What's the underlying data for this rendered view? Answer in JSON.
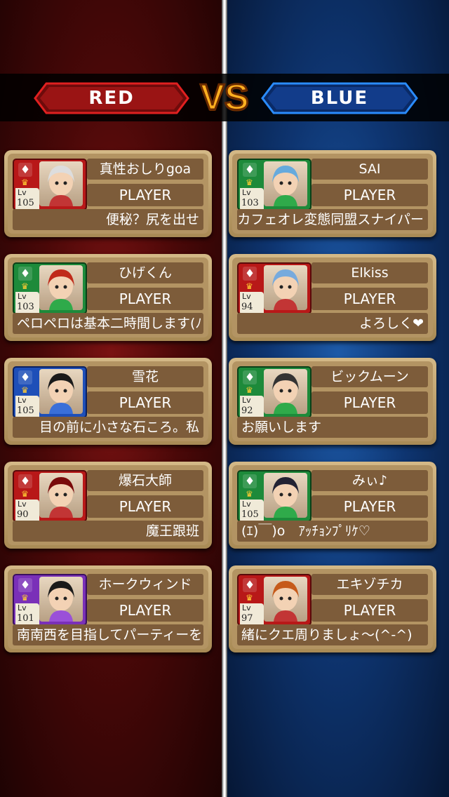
{
  "teams": {
    "red": "RED",
    "vs": "VS",
    "blue": "BLUE"
  },
  "colors": {
    "red_team": "#b81818",
    "blue_team": "#1e4fb8",
    "vs_orange": "#ffb020"
  },
  "red_players": [
    {
      "name": "真性おしりgoa",
      "role": "PLAYER",
      "level": "105",
      "lv_label": "Lv",
      "message": "便秘？尻を出せ",
      "frame": "red",
      "gem": "♦"
    },
    {
      "name": "ひげくん",
      "role": "PLAYER",
      "level": "103",
      "lv_label": "Lv",
      "message": "ペロペロは基本二時間します(ﾉ",
      "frame": "green",
      "gem": "♦"
    },
    {
      "name": "雪花",
      "role": "PLAYER",
      "level": "105",
      "lv_label": "Lv",
      "message": "目の前に小さな石ころ。私",
      "frame": "blue",
      "gem": "♦"
    },
    {
      "name": "爆石大師",
      "role": "PLAYER",
      "level": "90",
      "lv_label": "Lv",
      "message": "魔王跟班",
      "frame": "red",
      "gem": "♦"
    },
    {
      "name": "ホークウィンド",
      "role": "PLAYER",
      "level": "101",
      "lv_label": "Lv",
      "message": "南南西を目指してパーティーを",
      "frame": "purple",
      "gem": "♦"
    }
  ],
  "blue_players": [
    {
      "name": "SAI",
      "role": "PLAYER",
      "level": "103",
      "lv_label": "Lv",
      "message": "カフェオレ変態同盟スナイパー",
      "frame": "green",
      "gem": "♦"
    },
    {
      "name": "Elkiss",
      "role": "PLAYER",
      "level": "94",
      "lv_label": "Lv",
      "message": "よろしく❤",
      "frame": "red",
      "gem": "♦"
    },
    {
      "name": "ビックムーン",
      "role": "PLAYER",
      "level": "92",
      "lv_label": "Lv",
      "message": "お願いします",
      "frame": "green",
      "gem": "♦"
    },
    {
      "name": "みぃ♪",
      "role": "PLAYER",
      "level": "105",
      "lv_label": "Lv",
      "message": "(ｴ)￣)o　ｱｯﾁｮﾝﾌﾟﾘｹ♡",
      "frame": "green",
      "gem": "♦"
    },
    {
      "name": "エキゾチカ",
      "role": "PLAYER",
      "level": "97",
      "lv_label": "Lv",
      "message": "緒にクエ周りましょ～(^-^)",
      "frame": "red",
      "gem": "♦"
    }
  ]
}
